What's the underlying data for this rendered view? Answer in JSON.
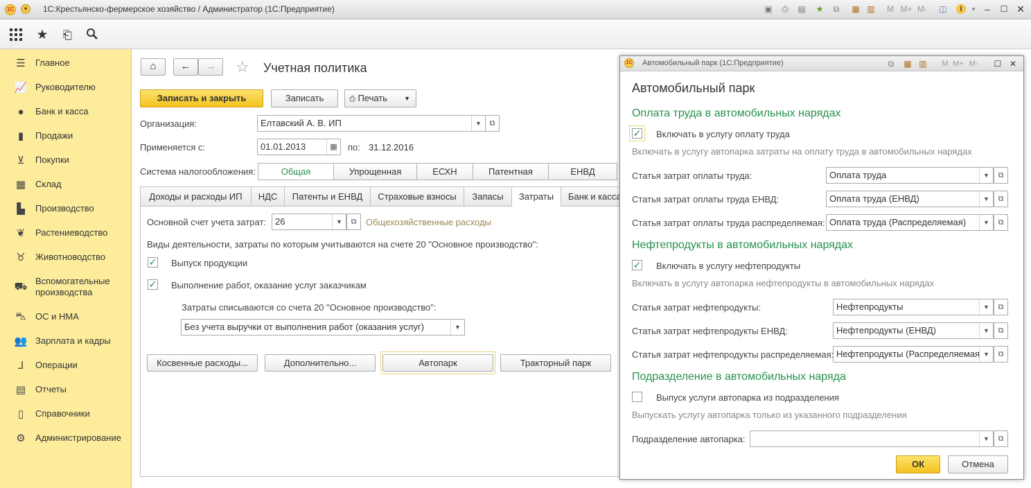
{
  "app": {
    "title": "1С:Крестьянско-фермерское хозяйство / Администратор  (1С:Предприятие)",
    "logo": "1С",
    "titlebar_icons": [
      "save-icon",
      "print-icon",
      "preview-icon",
      "favorite-icon",
      "link-icon",
      "calculator-icon",
      "calendar-icon",
      "m-icon",
      "mplus-icon",
      "mminus-icon",
      "panel-icon",
      "info-icon",
      "minimize-icon",
      "maximize-icon",
      "close-icon"
    ],
    "m_labels": {
      "m": "M",
      "mplus": "M+",
      "mminus": "M-"
    }
  },
  "toolbar": {
    "icons": [
      "apps-grid-icon",
      "star-icon",
      "history-icon",
      "search-icon"
    ]
  },
  "sidebar": {
    "items": [
      {
        "label": "Главное",
        "icon": "menu-icon"
      },
      {
        "label": "Руководителю",
        "icon": "chart-icon"
      },
      {
        "label": "Банк и касса",
        "icon": "coin-icon"
      },
      {
        "label": "Продажи",
        "icon": "bag-icon"
      },
      {
        "label": "Покупки",
        "icon": "cart-icon"
      },
      {
        "label": "Склад",
        "icon": "warehouse-icon"
      },
      {
        "label": "Производство",
        "icon": "factory-icon"
      },
      {
        "label": "Растениеводство",
        "icon": "leaf-icon"
      },
      {
        "label": "Животноводство",
        "icon": "cow-icon"
      },
      {
        "label": "Вспомогательные производства",
        "icon": "tractor-icon"
      },
      {
        "label": "ОС и НМА",
        "icon": "truck-icon"
      },
      {
        "label": "Зарплата и кадры",
        "icon": "people-icon"
      },
      {
        "label": "Операции",
        "icon": "operations-icon"
      },
      {
        "label": "Отчеты",
        "icon": "reports-icon"
      },
      {
        "label": "Справочники",
        "icon": "books-icon"
      },
      {
        "label": "Администрирование",
        "icon": "gear-icon"
      }
    ]
  },
  "form": {
    "title": "Учетная политика",
    "buttons": {
      "save_close": "Записать и закрыть",
      "save": "Записать",
      "print": "Печать"
    },
    "org_label": "Организация:",
    "org_value": "Елтавский А. В. ИП",
    "applies_label": "Применяется с:",
    "applies_value": "01.01.2013",
    "to_label": "по:",
    "to_value": "31.12.2016",
    "tax_label": "Система налогообложения:",
    "tax_options": [
      "Общая",
      "Упрощенная",
      "ЕСХН",
      "Патентная",
      "ЕНВД"
    ],
    "tax_selected": "Общая",
    "tabs": [
      "Доходы и расходы ИП",
      "НДС",
      "Патенты и ЕНВД",
      "Страховые взносы",
      "Запасы",
      "Затраты",
      "Банк и касса"
    ],
    "active_tab": "Затраты",
    "cost_account_label": "Основной счет учета затрат:",
    "cost_account_value": "26",
    "cost_account_desc": "Общехозяйственные расходы",
    "activities_label": "Виды деятельности, затраты по которым учитываются на счете 20 \"Основное производство\":",
    "cb_output": "Выпуск продукции",
    "cb_output_checked": true,
    "cb_services": "Выполнение работ, оказание услуг заказчикам",
    "cb_services_checked": true,
    "writeoff_label": "Затраты списываются со счета 20 \"Основное производство\":",
    "writeoff_value": "Без учета выручки от выполнения работ (оказания услуг)",
    "bottom_buttons": [
      "Косвенные расходы...",
      "Дополнительно...",
      "Автопарк",
      "Тракторный парк"
    ]
  },
  "dialog": {
    "window_title": "Автомобильный парк  (1С:Предприятие)",
    "heading": "Автомобильный парк",
    "sections": [
      {
        "title": "Оплата труда в автомобильных нарядах",
        "checkbox": "Включать в услугу оплату труда",
        "checked": true,
        "hint": "Включать в услугу автопарка затраты на оплату труда в автомобильных нарядах",
        "fields": [
          {
            "label": "Статья затрат оплаты труда:",
            "value": "Оплата труда"
          },
          {
            "label": "Статья затрат оплаты труда ЕНВД:",
            "value": "Оплата труда (ЕНВД)"
          },
          {
            "label": "Статья затрат оплаты труда распределяемая:",
            "value": "Оплата труда (Распределяемая)"
          }
        ]
      },
      {
        "title": "Нефтепродукты в автомобильных нарядах",
        "checkbox": "Включать в услугу нефтепродукты",
        "checked": true,
        "hint": "Включать в услугу автопарка нефтепродукты в автомобильных нарядах",
        "fields": [
          {
            "label": "Статья затрат нефтепродукты:",
            "value": "Нефтепродукты"
          },
          {
            "label": "Статья затрат нефтепродукты ЕНВД:",
            "value": "Нефтепродукты (ЕНВД)"
          },
          {
            "label": "Статья затрат нефтепродукты распределяемая:",
            "value": "Нефтепродукты (Распределяемая"
          }
        ]
      },
      {
        "title": "Подразделение в автомобильных наряда",
        "checkbox": "Выпуск услуги автопарка из подразделения",
        "checked": false,
        "hint": "Выпускать услугу автопарка только из указанного подразделения",
        "fields": [
          {
            "label": "Подразделение автопарка:",
            "value": ""
          }
        ]
      }
    ],
    "ok": "ОК",
    "cancel": "Отмена"
  },
  "colors": {
    "sidebar": "#fcec9c",
    "accent_green": "#26914d",
    "primary_button": "#f6c82a"
  }
}
